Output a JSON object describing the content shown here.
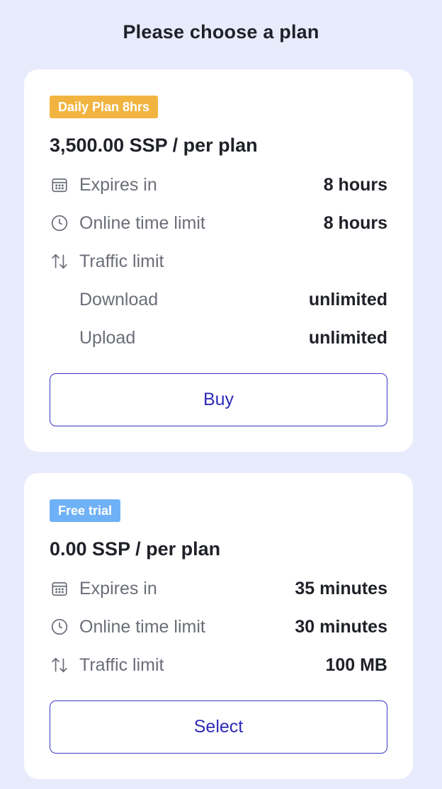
{
  "header": {
    "title": "Please choose a plan"
  },
  "colors": {
    "background": "#e8ebfb",
    "badge_daily": "#f2b441",
    "badge_trial": "#6fb1f6",
    "button_accent": "#3b36c2"
  },
  "plans": [
    {
      "badge": "Daily Plan 8hrs",
      "badge_color": "#f2b441",
      "price": "3,500.00 SSP",
      "price_suffix": " / per plan",
      "expires_label": "Expires in",
      "expires_value": "8 hours",
      "online_label": "Online time limit",
      "online_value": "8 hours",
      "traffic_label": "Traffic limit",
      "traffic_value": "",
      "download_label": "Download",
      "download_value": "unlimited",
      "upload_label": "Upload",
      "upload_value": "unlimited",
      "button_label": "Buy",
      "icons": [
        "calendar-icon",
        "clock-icon",
        "arrows-up-down-icon"
      ]
    },
    {
      "badge": "Free trial",
      "badge_color": "#6fb1f6",
      "price": "0.00 SSP",
      "price_suffix": " / per plan",
      "expires_label": "Expires in",
      "expires_value": "35 minutes",
      "online_label": "Online time limit",
      "online_value": "30 minutes",
      "traffic_label": "Traffic limit",
      "traffic_value": "100 MB",
      "button_label": "Select",
      "icons": [
        "calendar-icon",
        "clock-icon",
        "arrows-up-down-icon"
      ]
    }
  ]
}
